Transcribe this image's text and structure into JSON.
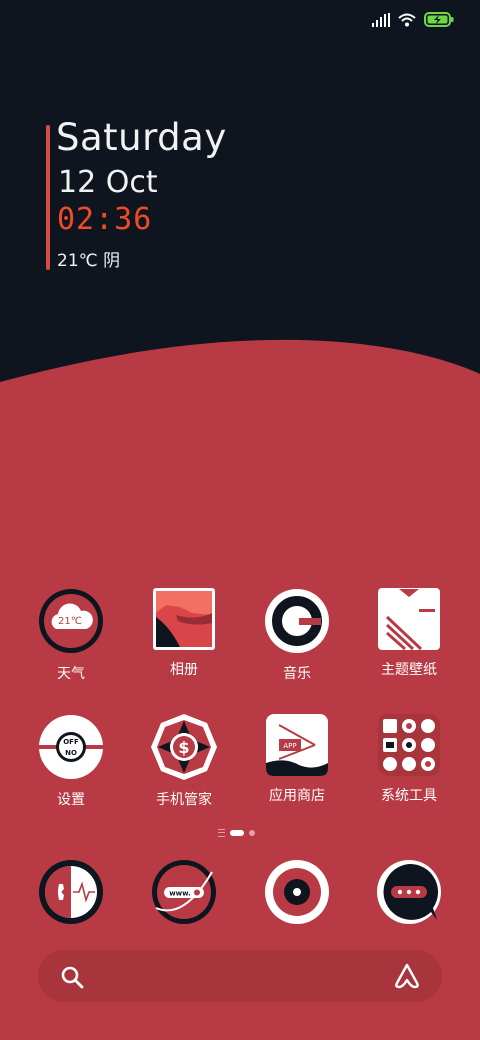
{
  "clock": {
    "day": "Saturday",
    "date": "12 Oct",
    "time": "02:36",
    "weather": "21℃ 阴"
  },
  "status_bar": {
    "signal_icon": "signal-icon",
    "wifi_icon": "wifi-icon",
    "battery_icon": "battery-charging-icon"
  },
  "apps_row1": [
    {
      "label": "天气",
      "icon": "weather-icon",
      "badge": "21℃"
    },
    {
      "label": "相册",
      "icon": "gallery-icon"
    },
    {
      "label": "音乐",
      "icon": "music-icon"
    },
    {
      "label": "主题壁纸",
      "icon": "themes-icon"
    }
  ],
  "apps_row2": [
    {
      "label": "设置",
      "icon": "settings-icon",
      "toggle_on": "OFF",
      "toggle_off": "NO"
    },
    {
      "label": "手机管家",
      "icon": "security-icon"
    },
    {
      "label": "应用商店",
      "icon": "app-store-icon",
      "badge": "APP"
    },
    {
      "label": "系统工具",
      "icon": "system-tools-folder-icon"
    }
  ],
  "dock": [
    {
      "name": "phone",
      "icon": "phone-icon"
    },
    {
      "name": "browser",
      "icon": "browser-icon",
      "badge": "www."
    },
    {
      "name": "camera",
      "icon": "camera-icon"
    },
    {
      "name": "messages",
      "icon": "messages-icon"
    }
  ],
  "page_indicator": {
    "pages": 2,
    "current": 1
  },
  "search": {
    "search_icon": "search-icon",
    "assistant_icon": "assistant-icon"
  },
  "colors": {
    "dark": "#0f151e",
    "red": "#b83a44",
    "accent": "#f04a28",
    "white": "#ffffff"
  }
}
